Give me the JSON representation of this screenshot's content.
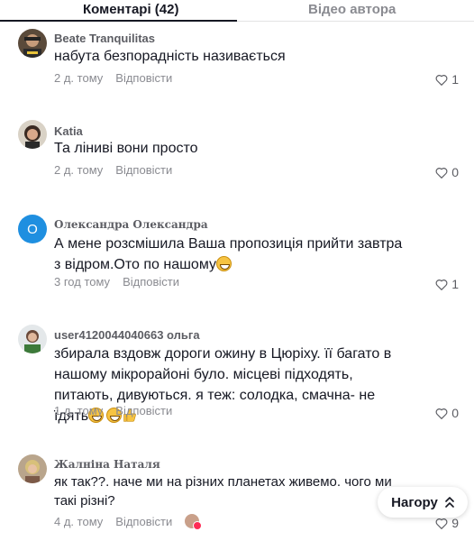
{
  "tabs": [
    {
      "label": "Коментарі (42)",
      "active": true
    },
    {
      "label": "Відео автора",
      "active": false
    }
  ],
  "comments": [
    {
      "author": "Beate Tranquilitas",
      "text": "набута безпорадність називається",
      "time": "2 д. тому",
      "reply": "Відповісти",
      "likes": "1"
    },
    {
      "author": "Katia",
      "text": "Та ліниві вони просто",
      "time": "2 д. тому",
      "reply": "Відповісти",
      "likes": "0"
    },
    {
      "author": "Олександра Олександра",
      "avatar_letter": "O",
      "text": "А мене розсмішила Ваша пропозиція прийти завтра з відром.Ото по нашому",
      "time": "3 год тому",
      "reply": "Відповісти",
      "likes": "1"
    },
    {
      "author": "user4120044040663 ольга",
      "text": "збирала вздовж дороги ожину в Цюріху. її багато в нашому мікрорайоні було. місцеві підходять, питають, дивуються. я теж: солодка, смачна- не їдять",
      "time": "1 д. тому",
      "reply": "Відповісти",
      "likes": "0"
    },
    {
      "author": "Жалніна Наталя",
      "text": "як так??. наче ми на різних планетах живемо. чого ми такі різні?",
      "time": "4 д. тому",
      "reply": "Відповісти",
      "likes": "9"
    }
  ],
  "back_to_top": "Нагору",
  "colors": {
    "accent_avatar": "#1f8fe0",
    "secondary_text": "#8a8b91",
    "primary_text": "#161823"
  },
  "icons": [
    "heart-outline-icon",
    "chevron-up-icon",
    "grin-emoji-icon",
    "thumbs-up-emoji-icon"
  ]
}
